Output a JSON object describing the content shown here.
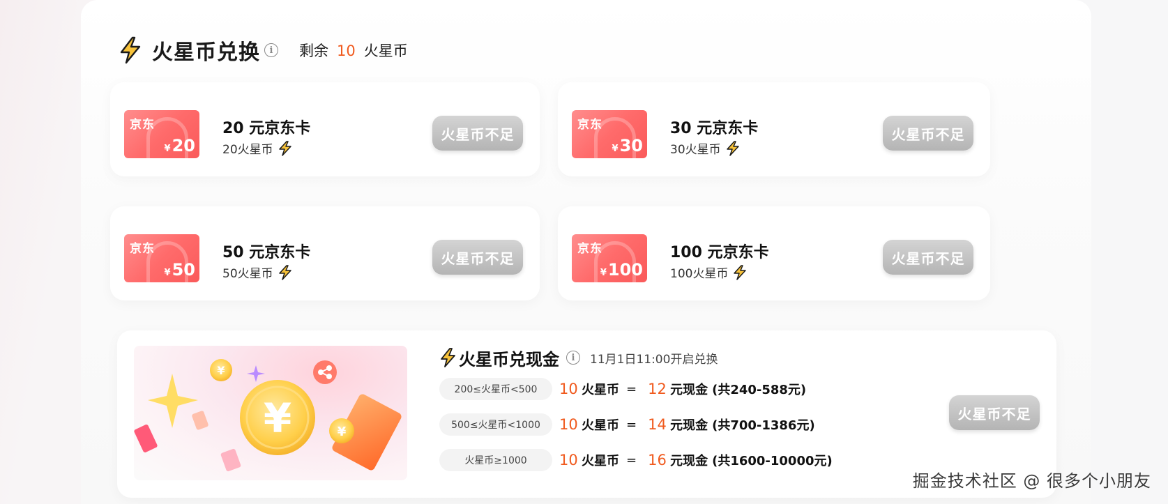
{
  "header": {
    "title": "火星币兑换",
    "balance_prefix": "剩余",
    "balance_value": "10",
    "balance_unit": "火星币"
  },
  "gift_cards": [
    {
      "name": "20 元京东卡",
      "cost": "20火星币",
      "brand": "京东",
      "face_value": "20",
      "button": "火星币不足"
    },
    {
      "name": "30 元京东卡",
      "cost": "30火星币",
      "brand": "京东",
      "face_value": "30",
      "button": "火星币不足"
    },
    {
      "name": "50 元京东卡",
      "cost": "50火星币",
      "brand": "京东",
      "face_value": "50",
      "button": "火星币不足"
    },
    {
      "name": "100 元京东卡",
      "cost": "100火星币",
      "brand": "京东",
      "face_value": "100",
      "button": "火星币不足"
    }
  ],
  "cash": {
    "title": "火星币兑现金",
    "open_time": "11月1日11:00开启兑换",
    "button": "火星币不足",
    "tiers": [
      {
        "range": "200≤火星币<500",
        "coins": "10",
        "coin_label": "火星币",
        "eq": "=",
        "cash": "12",
        "cash_label": "元现金",
        "total": "(共240-588元)"
      },
      {
        "range": "500≤火星币<1000",
        "coins": "10",
        "coin_label": "火星币",
        "eq": "=",
        "cash": "14",
        "cash_label": "元现金",
        "total": "(共700-1386元)"
      },
      {
        "range": "火星币≥1000",
        "coins": "10",
        "coin_label": "火星币",
        "eq": "=",
        "cash": "16",
        "cash_label": "元现金",
        "total": "(共1600-10000元)"
      }
    ]
  },
  "currency_symbol": "¥",
  "info_glyph": "i",
  "watermark": "掘金技术社区 @ 很多个小朋友",
  "colors": {
    "accent": "#f05a1e",
    "bolt": "#f7c23a",
    "disabled_button": "#bdbdbd",
    "jd_red": "#ff6b6b"
  },
  "icons": [
    "lightning-bolt-icon",
    "info-icon",
    "jd-card-image",
    "cash-coin-illustration",
    "share-icon"
  ]
}
